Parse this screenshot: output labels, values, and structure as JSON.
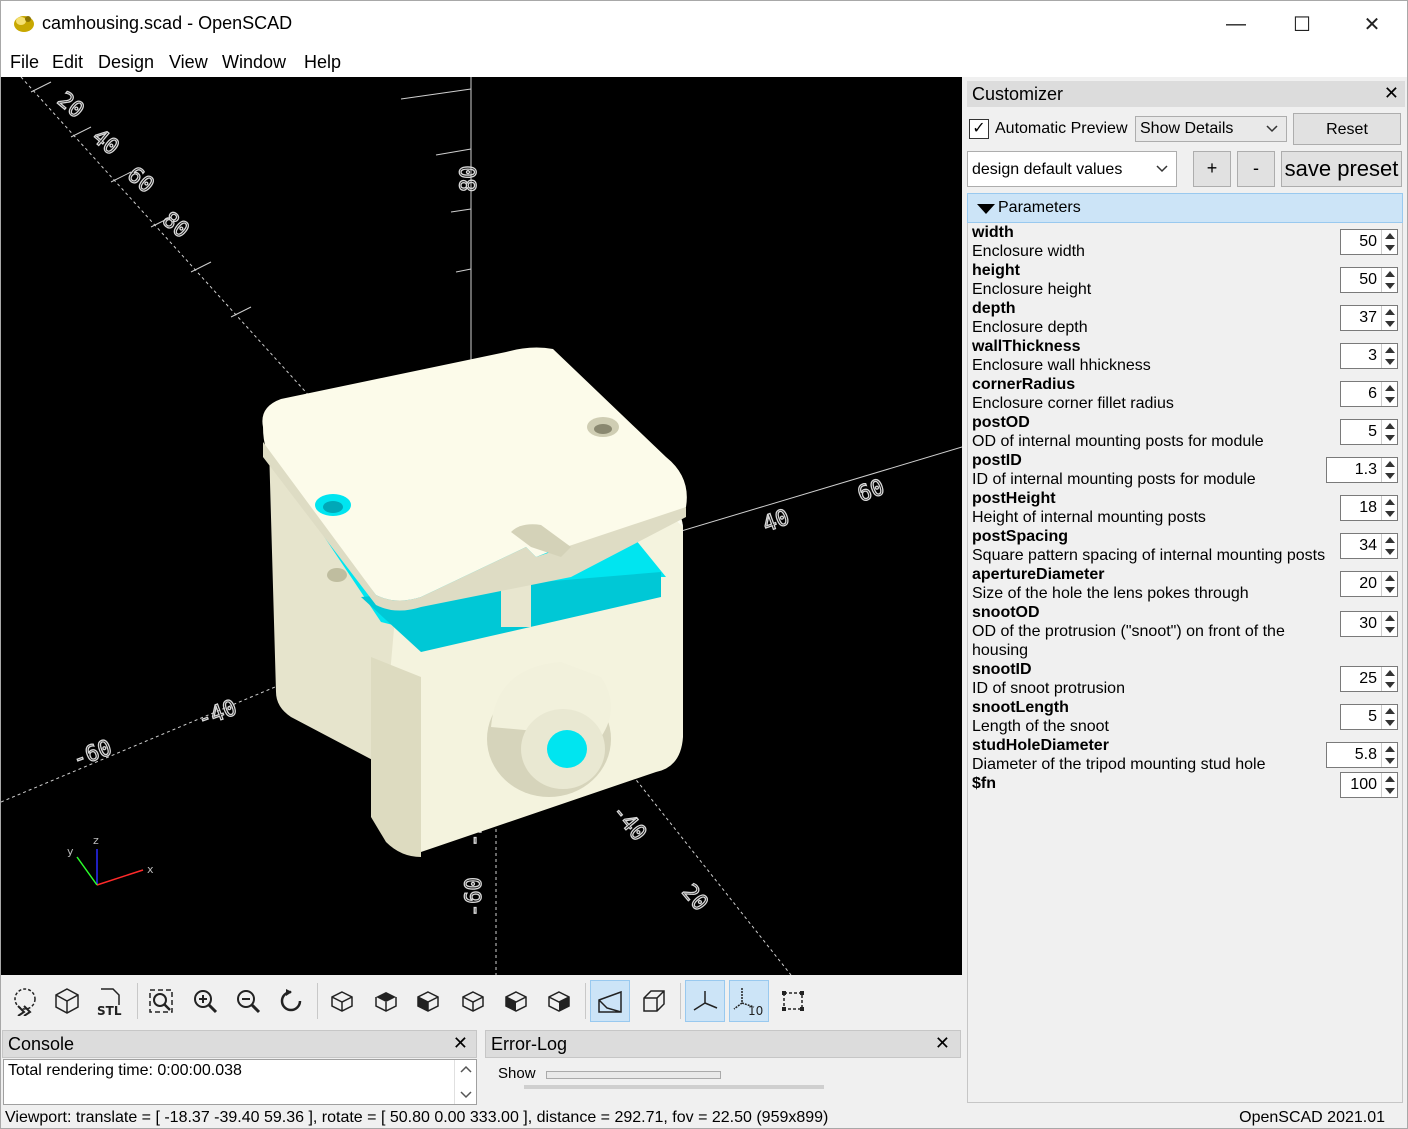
{
  "window": {
    "title": "camhousing.scad - OpenSCAD",
    "minimize": "—",
    "maximize": "☐",
    "close": "✕"
  },
  "menu": [
    "File",
    "Edit",
    "Design",
    "View",
    "Window",
    "Help"
  ],
  "viewport": {
    "axis_labels": {
      "x": "x",
      "y": "y",
      "z": "z"
    },
    "ruler_marks": [
      "20",
      "40",
      "60",
      "80",
      "-40",
      "-60",
      "40",
      "60",
      "80",
      "-20",
      "-40",
      "-60",
      "20"
    ]
  },
  "toolbar": {
    "buttons": [
      "preview",
      "render",
      "export-stl",
      "view-all",
      "zoom-in",
      "zoom-out",
      "reset-view",
      "view-right",
      "view-top",
      "view-bottom",
      "view-left",
      "view-front",
      "view-back",
      "perspective",
      "orthogonal",
      "show-axes",
      "show-scale-markers",
      "show-edges"
    ],
    "stl_label": "STL",
    "scale_label": "10"
  },
  "console": {
    "title": "Console",
    "close": "✕",
    "lines": [
      "Total rendering time: 0:00:00.038"
    ]
  },
  "errorlog": {
    "title": "Error-Log",
    "close": "✕",
    "show_label": "Show"
  },
  "status": {
    "viewport": "Viewport: translate = [ -18.37 -39.40 59.36 ], rotate = [ 50.80 0.00 333.00 ], distance = 292.71, fov = 22.50 (959x899)",
    "version": "OpenSCAD 2021.01"
  },
  "customizer": {
    "title": "Customizer",
    "close": "✕",
    "auto_preview_label": "Automatic Preview",
    "auto_preview_checked": "✓",
    "details_select": "Show Details",
    "reset_label": "Reset",
    "preset_select": "design default values",
    "plus_label": "+",
    "minus_label": "-",
    "save_preset_label": "save preset",
    "section_label": "Parameters",
    "params": [
      {
        "name": "width",
        "desc": "Enclosure width",
        "value": "50"
      },
      {
        "name": "height",
        "desc": "Enclosure height",
        "value": "50"
      },
      {
        "name": "depth",
        "desc": "Enclosure depth",
        "value": "37"
      },
      {
        "name": "wallThickness",
        "desc": "Enclosure wall hhickness",
        "value": "3"
      },
      {
        "name": "cornerRadius",
        "desc": "Enclosure corner fillet radius",
        "value": "6"
      },
      {
        "name": "postOD",
        "desc": "OD of internal mounting posts for module",
        "value": "5"
      },
      {
        "name": "postID",
        "desc": "ID of internal mounting posts for module",
        "value": "1.3"
      },
      {
        "name": "postHeight",
        "desc": "Height of internal mounting posts",
        "value": "18"
      },
      {
        "name": "postSpacing",
        "desc": "Square pattern spacing of internal mounting posts",
        "value": "34"
      },
      {
        "name": "apertureDiameter",
        "desc": "Size of the hole the lens pokes through",
        "value": "20"
      },
      {
        "name": "snootOD",
        "desc": "OD of the protrusion (\"snoot\") on front of the housing",
        "value": "30"
      },
      {
        "name": "snootID",
        "desc": "ID of snoot protrusion",
        "value": "25"
      },
      {
        "name": "snootLength",
        "desc": "Length of the snoot",
        "value": "5"
      },
      {
        "name": "studHoleDiameter",
        "desc": "Diameter of the tripod mounting stud hole",
        "value": "5.8"
      },
      {
        "name": "$fn",
        "desc": "",
        "value": "100"
      }
    ]
  }
}
